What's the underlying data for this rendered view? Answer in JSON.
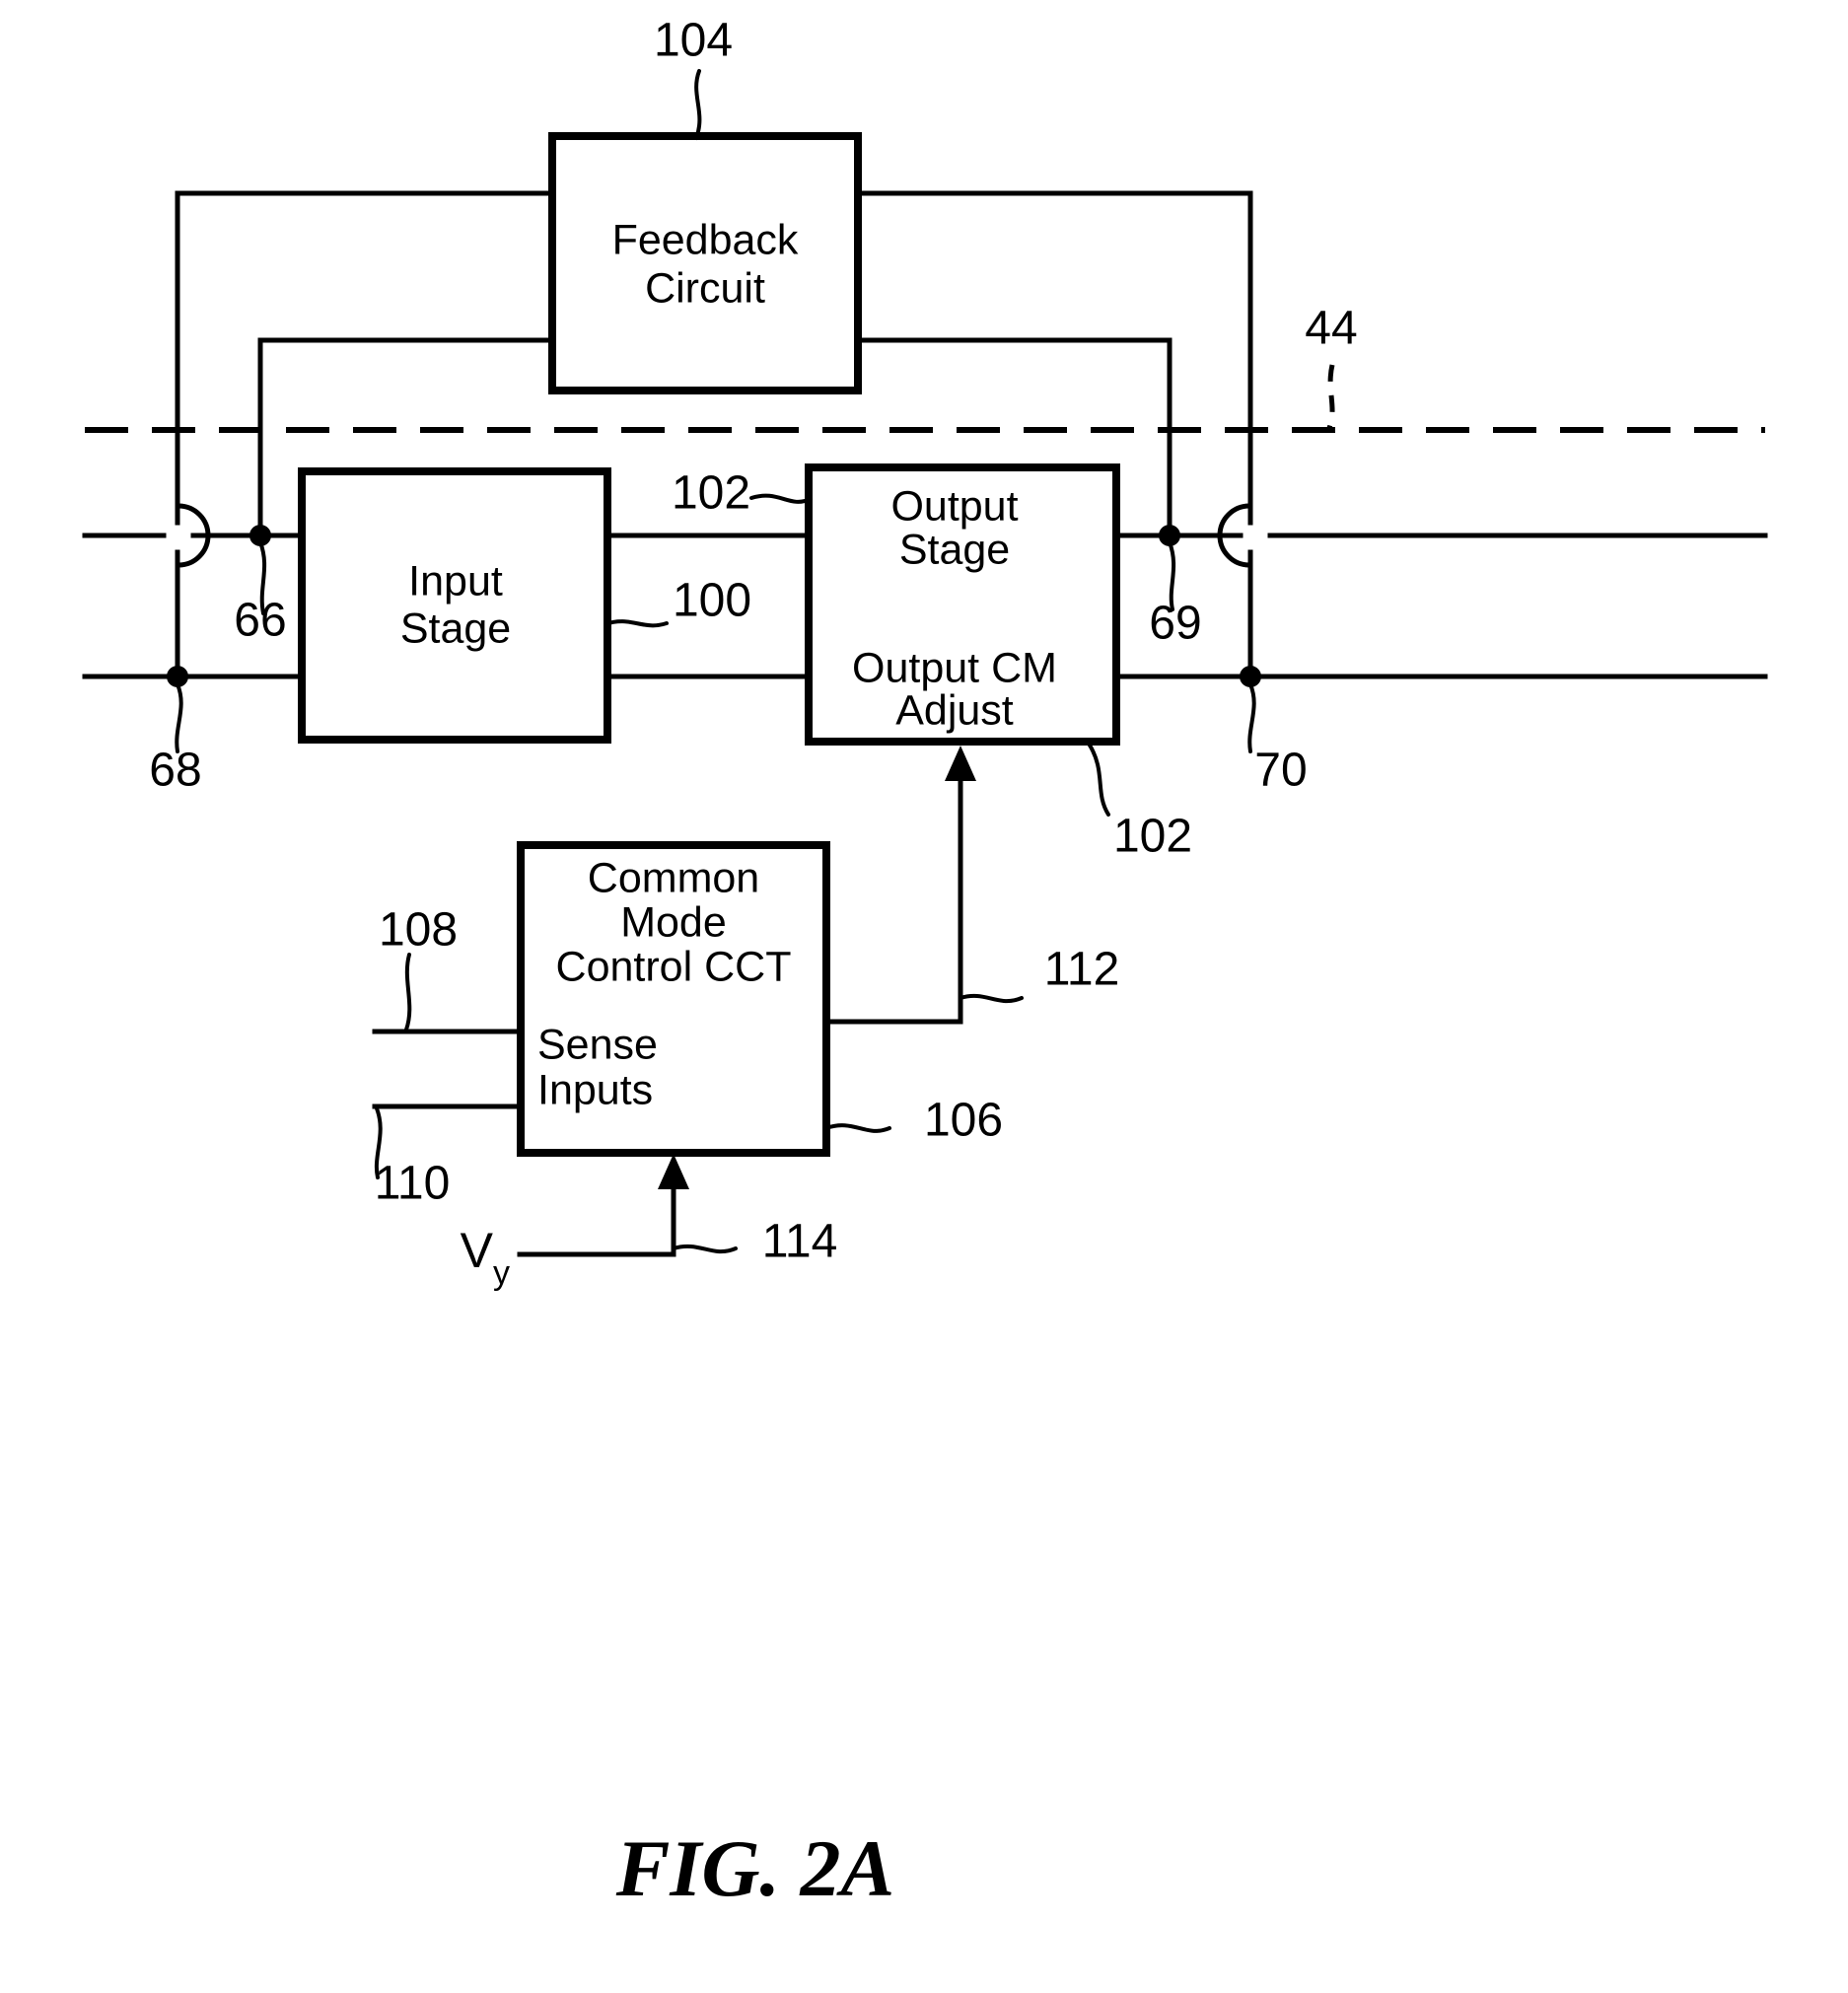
{
  "figure": {
    "caption": "FIG. 2A",
    "kind": "patent-block-diagram"
  },
  "blocks": {
    "feedback": {
      "line1": "Feedback",
      "line2": "Circuit",
      "ref": "104"
    },
    "input_stage": {
      "line1": "Input",
      "line2": "Stage"
    },
    "output_stage": {
      "line1": "Output",
      "line2": "Stage",
      "line3": "Output CM",
      "line4": "Adjust",
      "ref_top": "102",
      "ref_bottom": "102"
    },
    "cm_control": {
      "line1": "Common",
      "line2": "Mode",
      "line3": "Control CCT",
      "line4": "Sense",
      "line5": "Inputs",
      "ref": "106"
    }
  },
  "reference_numerals": {
    "feedback_circuit": "104",
    "boundary_line": "44",
    "input_node_66": "66",
    "input_node_68": "68",
    "output_node_69": "69",
    "output_node_70": "70",
    "interconnect_100": "100",
    "output_stage_top": "102",
    "output_stage_bottom": "102",
    "cm_control_106": "106",
    "sense_input_108": "108",
    "sense_input_110": "110",
    "cm_adjust_line_112": "112",
    "vy_input_114": "114"
  },
  "signals": {
    "vy": "V",
    "vy_subscript": "y"
  }
}
